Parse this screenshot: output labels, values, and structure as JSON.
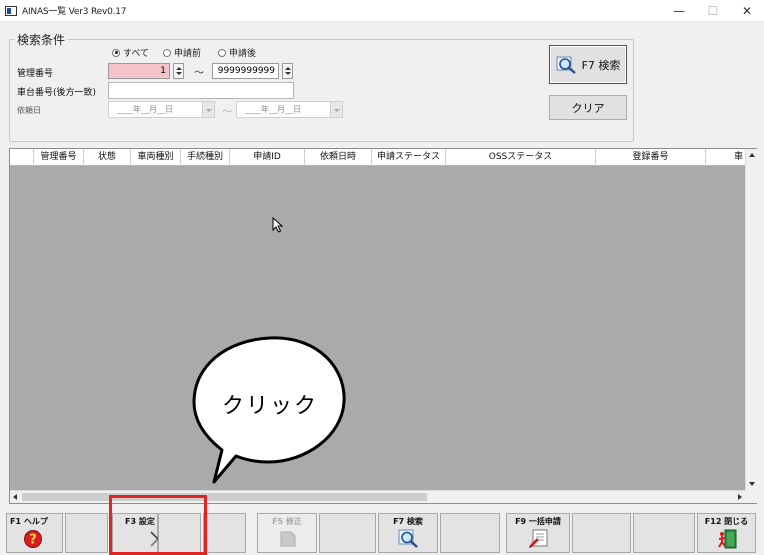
{
  "window": {
    "title": "AINAS一覧 Ver3 Rev0.17",
    "minimize": "—",
    "maximize": "☐",
    "close": "✕"
  },
  "search": {
    "legend": "検索条件",
    "radios": [
      {
        "label": "すべて",
        "selected": true
      },
      {
        "label": "申請前",
        "selected": false
      },
      {
        "label": "申請後",
        "selected": false
      }
    ],
    "mgmt_label": "管理番号",
    "mgmt_from": "1",
    "mgmt_to": "9999999999",
    "range_sep": "〜",
    "chassis_label": "車台番号(後方一致)",
    "chassis_value": "",
    "request_date_label": "依頼日",
    "date_from_placeholder": "____年__月__日",
    "date_to_placeholder": "____年__月__日",
    "search_button": "F7 検索",
    "clear_button": "クリア"
  },
  "grid": {
    "columns": [
      "管理番号",
      "状態",
      "車両種別",
      "手続種別",
      "申請ID",
      "依頼日時",
      "申請ステータス",
      "OSSステータス",
      "登録番号",
      "車"
    ]
  },
  "callout": {
    "text": "クリック"
  },
  "fkeys": {
    "f1": "F1 ヘルプ",
    "f3": "F3 設定",
    "f5": "F5 修正",
    "f7": "F7 検索",
    "f9": "F9 一括申請",
    "f12": "F12 閉じる"
  },
  "colors": {
    "highlight": "#e02424",
    "mgmt_from_bg": "#f4c2c8",
    "grid_bg": "#aaaaaa"
  }
}
